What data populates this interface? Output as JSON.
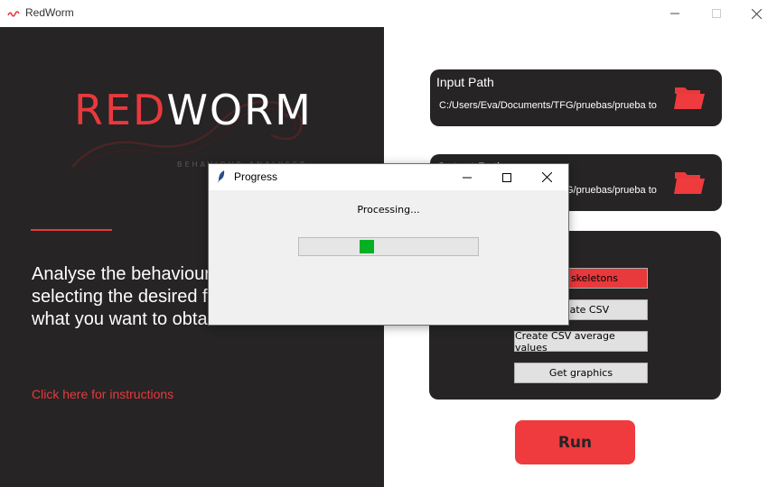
{
  "window": {
    "title": "RedWorm"
  },
  "left": {
    "logo_red": "RED",
    "logo_white": "WORM",
    "logo_subtitle": "BEHAVIOUR ANALYSER",
    "description": "Analyse the behaviour of C.elegans by selecting the desired folder and choosing what you want to obtain.",
    "instructions_link": "Click here for instructions"
  },
  "input_path": {
    "label": "Input Path",
    "value": "C:/Users/Eva/Documents/TFG/pruebas/prueba to"
  },
  "output_path": {
    "label": "Output Path",
    "value": "C:/Users/Eva/Documents/TFG/pruebas/prueba to"
  },
  "options": {
    "buttons": [
      {
        "label": "Plain skeletons",
        "selected": true
      },
      {
        "label": "Create CSV",
        "selected": false
      },
      {
        "label": "Create CSV average values",
        "selected": false
      },
      {
        "label": "Get graphics",
        "selected": false
      }
    ]
  },
  "run_label": "Run",
  "dialog": {
    "title": "Progress",
    "status": "Processing...",
    "progress": 0.37
  },
  "colors": {
    "accent": "#e8393d",
    "panel": "#262424",
    "progress_fill": "#06b025"
  }
}
